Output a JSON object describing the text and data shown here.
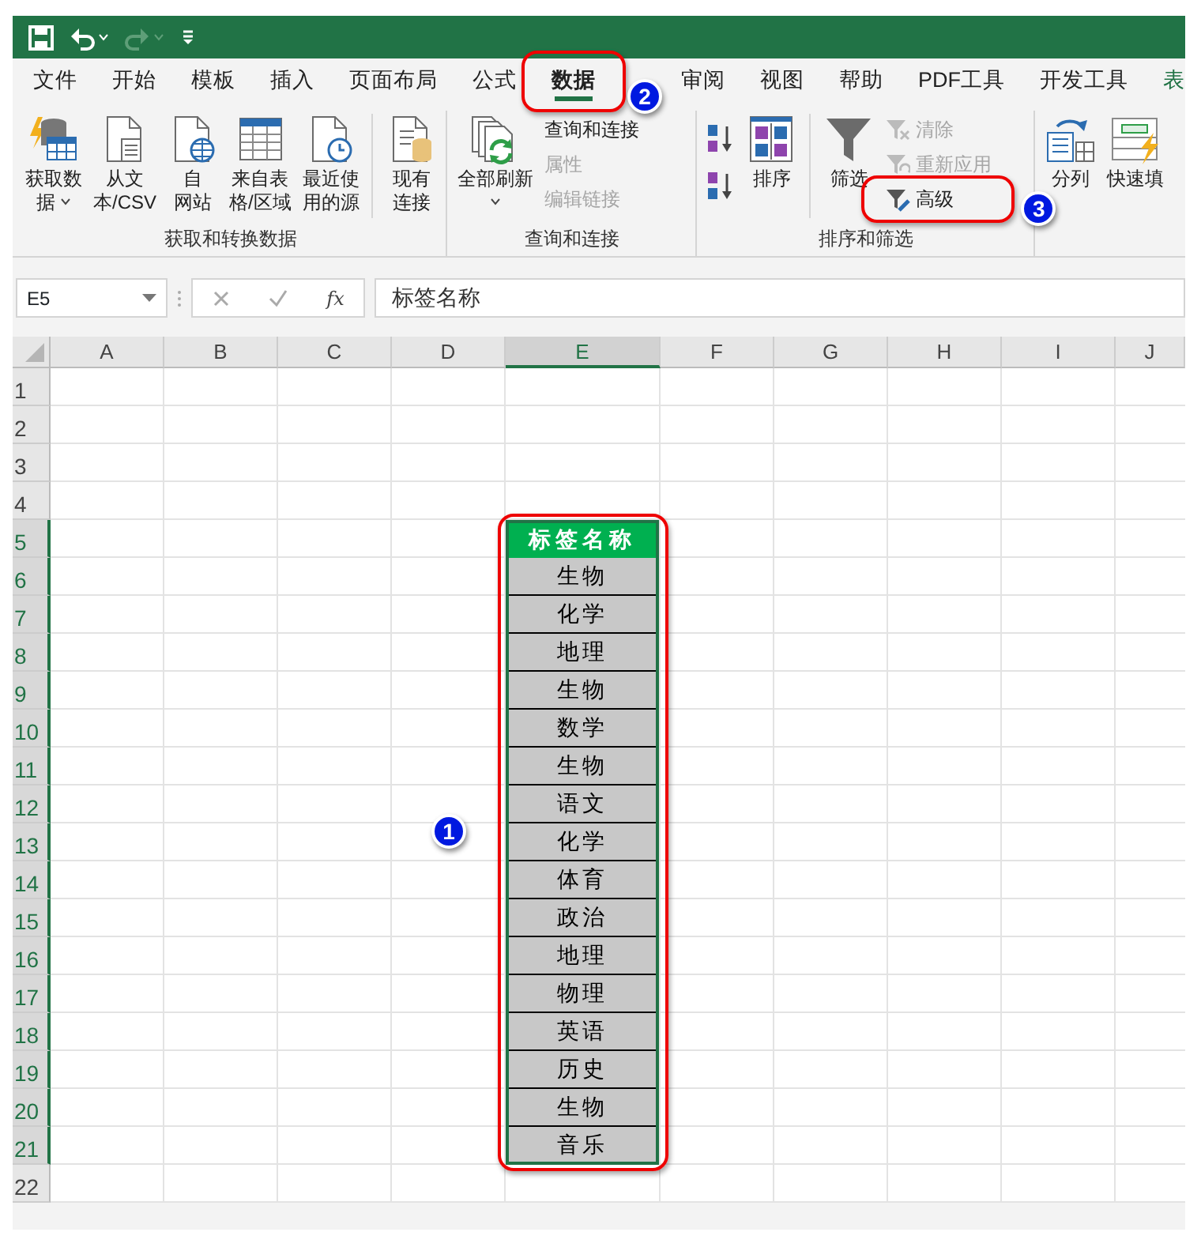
{
  "title_bar": {
    "quick_access": [
      {
        "kind": "save",
        "disabled": false
      },
      {
        "kind": "undo",
        "disabled": false
      },
      {
        "kind": "redo",
        "disabled": true
      },
      {
        "kind": "customize",
        "disabled": false
      }
    ]
  },
  "tabs": [
    {
      "label": "文件",
      "selected": false,
      "contextual": false
    },
    {
      "label": "开始",
      "selected": false,
      "contextual": false
    },
    {
      "label": "模板",
      "selected": false,
      "contextual": false
    },
    {
      "label": "插入",
      "selected": false,
      "contextual": false
    },
    {
      "label": "页面布局",
      "selected": false,
      "contextual": false
    },
    {
      "label": "公式",
      "selected": false,
      "contextual": false
    },
    {
      "label": "数据",
      "selected": true,
      "contextual": false,
      "callout": "2"
    },
    {
      "label": "审阅",
      "selected": false,
      "contextual": false
    },
    {
      "label": "视图",
      "selected": false,
      "contextual": false
    },
    {
      "label": "帮助",
      "selected": false,
      "contextual": false
    },
    {
      "label": "PDF工具",
      "selected": false,
      "contextual": false
    },
    {
      "label": "开发工具",
      "selected": false,
      "contextual": false
    },
    {
      "label": "表",
      "selected": false,
      "contextual": true
    }
  ],
  "ribbon": {
    "groups": [
      {
        "label": "获取和转换数据",
        "items": [
          {
            "kind": "large",
            "lines": [
              "获取数",
              "据"
            ],
            "dropdown": true
          },
          {
            "kind": "large",
            "lines": [
              "从文",
              "本/CSV"
            ],
            "dropdown": false
          },
          {
            "kind": "large",
            "lines": [
              "自",
              "网站"
            ],
            "dropdown": false
          },
          {
            "kind": "large",
            "lines": [
              "来自表",
              "格/区域"
            ],
            "dropdown": false
          },
          {
            "kind": "large",
            "lines": [
              "最近使",
              "用的源"
            ],
            "dropdown": false
          },
          {
            "kind": "separator"
          },
          {
            "kind": "large",
            "lines": [
              "现有",
              "连接"
            ],
            "dropdown": false
          }
        ]
      },
      {
        "label": "查询和连接",
        "items": [
          {
            "kind": "large",
            "lines": [
              "全部刷新"
            ],
            "dropdown": true
          },
          {
            "kind": "small_stack",
            "buttons": [
              {
                "label": "查询和连接",
                "disabled": false
              },
              {
                "label": "属性",
                "disabled": true
              },
              {
                "label": "编辑链接",
                "disabled": true
              }
            ]
          }
        ]
      },
      {
        "label": "排序和筛选",
        "items": [
          {
            "kind": "sort_pair"
          },
          {
            "kind": "large",
            "lines": [
              "排序"
            ],
            "dropdown": false
          },
          {
            "kind": "separator"
          },
          {
            "kind": "large",
            "lines": [
              "筛选"
            ],
            "dropdown": false
          },
          {
            "kind": "small_stack",
            "buttons": [
              {
                "label": "清除",
                "disabled": true
              },
              {
                "label": "重新应用",
                "disabled": true
              },
              {
                "label": "高级",
                "disabled": false,
                "callout": "3"
              }
            ]
          }
        ]
      },
      {
        "items": [
          {
            "kind": "large",
            "lines": [
              "分列"
            ],
            "dropdown": false
          },
          {
            "kind": "large",
            "lines": [
              "快速填"
            ],
            "dropdown": false
          }
        ]
      }
    ]
  },
  "formula_bar": {
    "name_box": "E5",
    "fx_label": "fx",
    "formula": "标签名称"
  },
  "sheet": {
    "columns": [
      {
        "label": "A",
        "selected": false
      },
      {
        "label": "B",
        "selected": false
      },
      {
        "label": "C",
        "selected": false
      },
      {
        "label": "D",
        "selected": false
      },
      {
        "label": "E",
        "selected": true
      },
      {
        "label": "F",
        "selected": false
      },
      {
        "label": "G",
        "selected": false
      },
      {
        "label": "H",
        "selected": false
      },
      {
        "label": "I",
        "selected": false
      },
      {
        "label": "J",
        "selected": false
      }
    ],
    "range_callout": "1",
    "rows": [
      {
        "label": "1",
        "selected": false
      },
      {
        "label": "2",
        "selected": false
      },
      {
        "label": "3",
        "selected": false
      },
      {
        "label": "4",
        "selected": false
      },
      {
        "label": "5",
        "selected": true,
        "e": "标签名称",
        "kind": "header"
      },
      {
        "label": "6",
        "selected": true,
        "e": "生物",
        "kind": "value"
      },
      {
        "label": "7",
        "selected": true,
        "e": "化学",
        "kind": "value"
      },
      {
        "label": "8",
        "selected": true,
        "e": "地理",
        "kind": "value"
      },
      {
        "label": "9",
        "selected": true,
        "e": "生物",
        "kind": "value"
      },
      {
        "label": "10",
        "selected": true,
        "e": "数学",
        "kind": "value"
      },
      {
        "label": "11",
        "selected": true,
        "e": "生物",
        "kind": "value"
      },
      {
        "label": "12",
        "selected": true,
        "e": "语文",
        "kind": "value"
      },
      {
        "label": "13",
        "selected": true,
        "e": "化学",
        "kind": "value"
      },
      {
        "label": "14",
        "selected": true,
        "e": "体育",
        "kind": "value"
      },
      {
        "label": "15",
        "selected": true,
        "e": "政治",
        "kind": "value"
      },
      {
        "label": "16",
        "selected": true,
        "e": "地理",
        "kind": "value"
      },
      {
        "label": "17",
        "selected": true,
        "e": "物理",
        "kind": "value"
      },
      {
        "label": "18",
        "selected": true,
        "e": "英语",
        "kind": "value"
      },
      {
        "label": "19",
        "selected": true,
        "e": "历史",
        "kind": "value"
      },
      {
        "label": "20",
        "selected": true,
        "e": "生物",
        "kind": "value"
      },
      {
        "label": "21",
        "selected": true,
        "e": "音乐",
        "kind": "value"
      },
      {
        "label": "22",
        "selected": false
      }
    ]
  }
}
